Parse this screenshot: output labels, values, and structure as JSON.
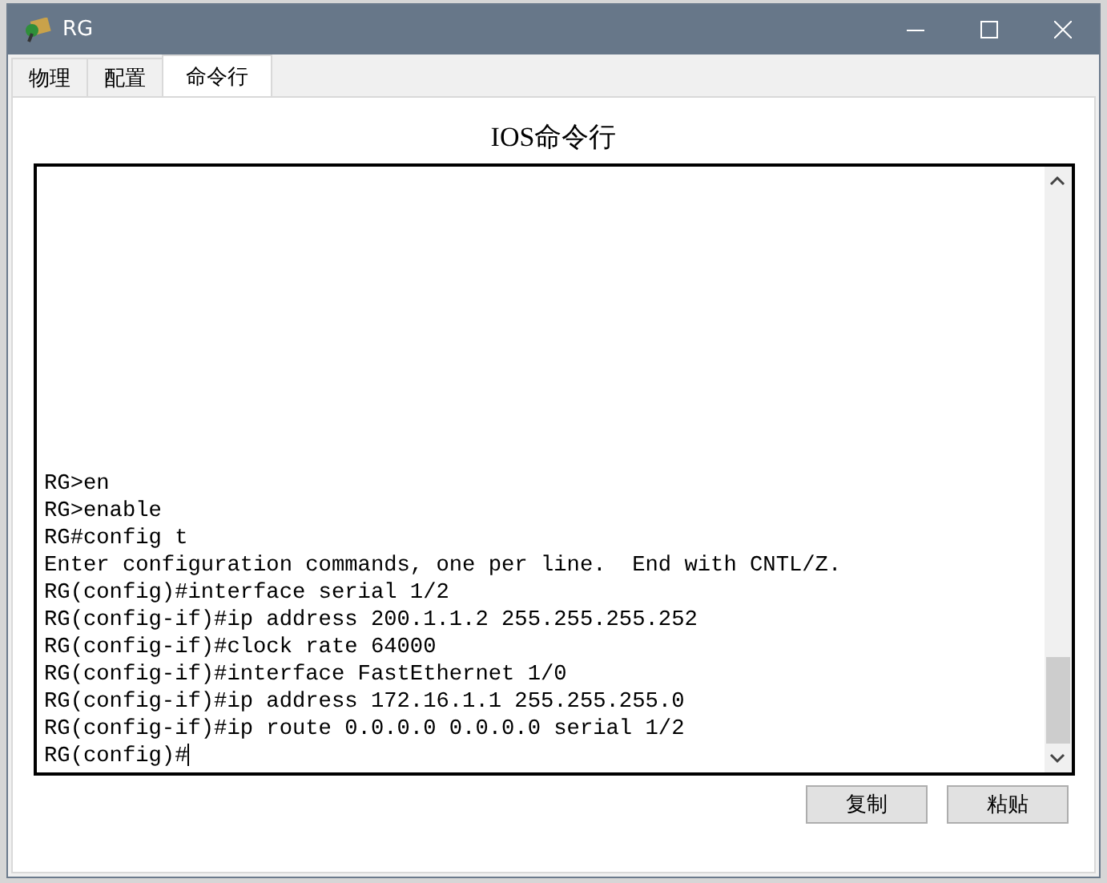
{
  "window": {
    "title": "RG"
  },
  "tabs": [
    {
      "label": "物理",
      "selected": false
    },
    {
      "label": "配置",
      "selected": false
    },
    {
      "label": "命令行",
      "selected": true
    }
  ],
  "heading": "IOS命令行",
  "terminal": {
    "lines": [
      "RG>en",
      "RG>enable",
      "RG#config t",
      "Enter configuration commands, one per line.  End with CNTL/Z.",
      "RG(config)#interface serial 1/2",
      "RG(config-if)#ip address 200.1.1.2 255.255.255.252",
      "RG(config-if)#clock rate 64000",
      "RG(config-if)#interface FastEthernet 1/0",
      "RG(config-if)#ip address 172.16.1.1 255.255.255.0",
      "RG(config-if)#ip route 0.0.0.0 0.0.0.0 serial 1/2",
      "RG(config)#"
    ]
  },
  "buttons": [
    "复制",
    "粘贴"
  ]
}
